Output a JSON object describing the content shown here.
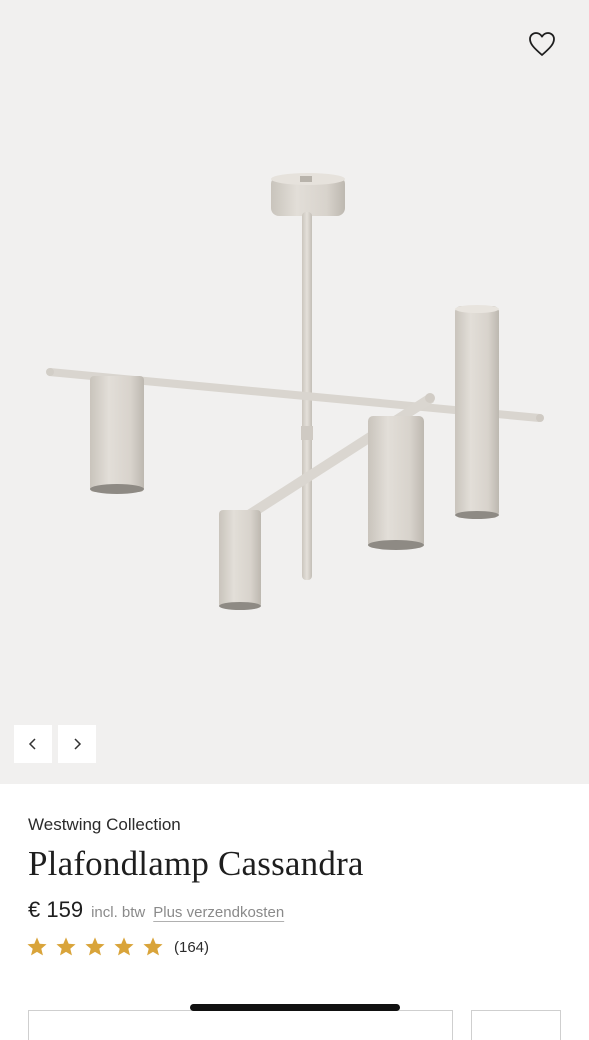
{
  "product": {
    "brand": "Westwing Collection",
    "title": "Plafondlamp Cassandra",
    "price": "€ 159",
    "tax_note": "incl. btw",
    "shipping_link": "Plus verzendkosten",
    "rating": {
      "stars": 5,
      "max_stars": 5,
      "review_count": "(164)"
    }
  },
  "colors": {
    "gallery_background": "#f1f0ef",
    "star": "#d9a43a",
    "lamp": "#d6d2cb"
  },
  "icons": {
    "wishlist": "heart-icon",
    "prev": "chevron-left-icon",
    "next": "chevron-right-icon",
    "star": "star-icon"
  }
}
